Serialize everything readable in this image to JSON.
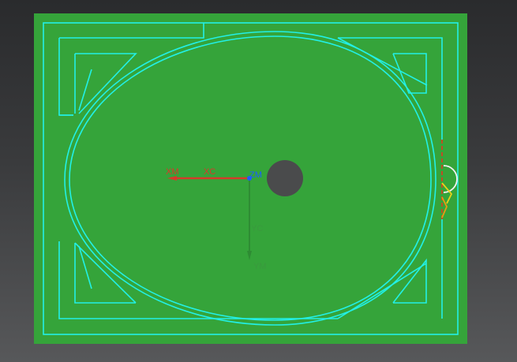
{
  "viewport": {
    "background_top": "#2a2b2d",
    "background_bottom": "#57585a"
  },
  "part": {
    "plate_color": "#35a43a",
    "edge_color": "#22f0e6",
    "hole_color": "#4a4b4c"
  },
  "triad": {
    "xm_label": "XM",
    "xc_label": "XC",
    "zm_label": "ZM",
    "yc_label": "YC",
    "ym_label": "YM",
    "x_axis_color": "#d63a2a",
    "y_axis_color": "#2e8c33",
    "z_axis_color": "#1e5cff"
  },
  "marker": {
    "colors": [
      "#f2f2f2",
      "#e8d21a",
      "#e03a1e",
      "#e89a12"
    ]
  }
}
